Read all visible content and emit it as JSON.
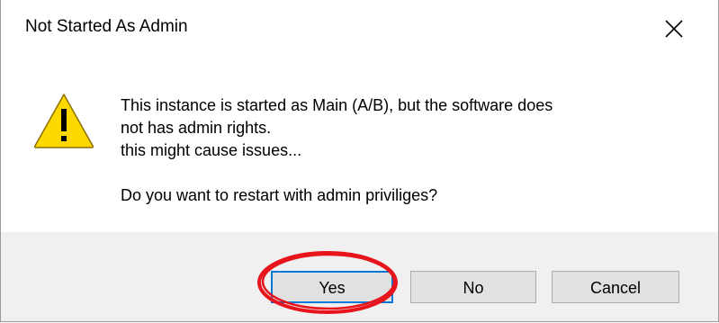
{
  "window": {
    "title": "Not Started As Admin",
    "close_icon": "close-icon"
  },
  "message": {
    "icon": "warning-icon",
    "lines": [
      "This instance is started as Main (A/B), but the software does",
      "not has admin rights.",
      "this might cause issues...",
      "",
      "Do you want to restart with admin priviliges?"
    ]
  },
  "buttons": {
    "yes": "Yes",
    "no": "No",
    "cancel": "Cancel"
  },
  "colors": {
    "focus_border": "#0078d7",
    "footer_bg": "#f0f0f0",
    "button_bg": "#e1e1e1",
    "warning_fill": "#ffd800",
    "annotation": "#e8141c"
  }
}
